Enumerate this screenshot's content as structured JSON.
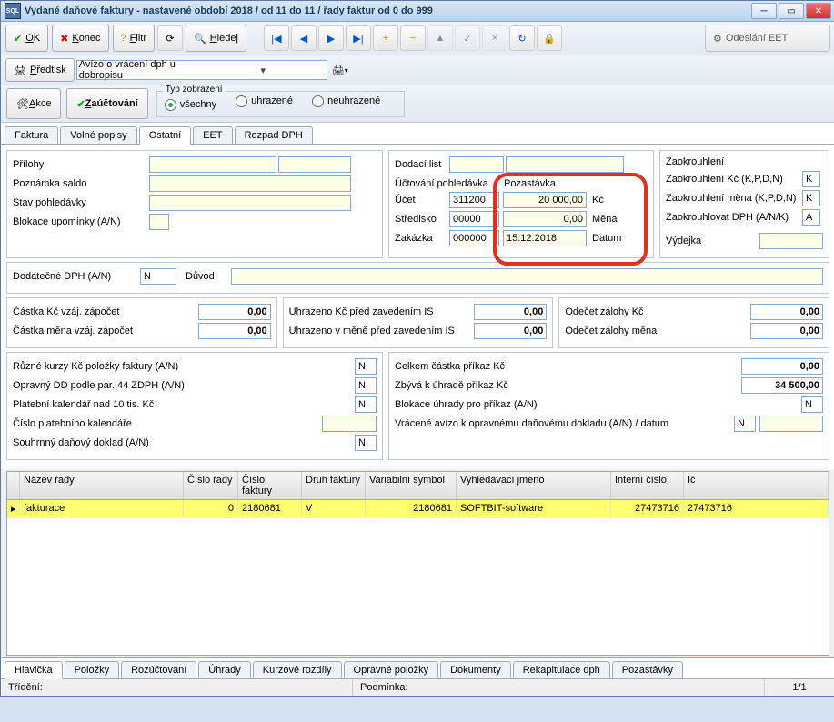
{
  "window": {
    "title": "Vydané daňové faktury - nastavené období 2018 / od 11 do 11 / řady faktur od 0 do 999"
  },
  "tb": {
    "ok": "OK",
    "konec": "Konec",
    "filtr": "Filtr",
    "hledej": "Hledej",
    "eet": "Odeslání EET",
    "predtisk": "Předtisk",
    "combo": "Avízo o vrácení dph u dobropisu",
    "akce": "Akce",
    "zauct": "Zaúčtování",
    "typ": "Typ zobrazení",
    "vsechny": "všechny",
    "uhrazene": "uhrazené",
    "neuhrazene": "neuhrazené"
  },
  "tabs": [
    "Faktura",
    "Volné popisy",
    "Ostatní",
    "EET",
    "Rozpad DPH"
  ],
  "active_tab": 2,
  "left": {
    "prilohy": "Přílohy",
    "poznamka": "Poznámka saldo",
    "stav": "Stav pohledávky",
    "blokace": "Blokace upomínky (A/N)"
  },
  "mid": {
    "dodaci": "Dodací list",
    "uctovani": "Účtování pohledávka",
    "ucet": "Účet",
    "ucet_v": "311200",
    "stred": "Středisko",
    "stred_v": "00000",
    "zak": "Zakázka",
    "zak_v": "000000",
    "pozast": "Pozastávka",
    "kc_v": "20 000,00",
    "kc": "Kč",
    "mena_v": "0,00",
    "mena": "Měna",
    "datum_v": "15.12.2018",
    "datum": "Datum"
  },
  "right": {
    "zaok_title": "Zaokrouhlení",
    "zaok_kc": "Zaokrouhlení Kč (K,P,D,N)",
    "zaok_kc_v": "K",
    "zaok_mena": "Zaokrouhlení měna (K,P,D,N)",
    "zaok_mena_v": "K",
    "zaok_dph": "Zaokrouhlovat DPH (A/N/K)",
    "zaok_dph_v": "A",
    "vydejka": "Výdejka"
  },
  "dph": {
    "lbl": "Dodatečné DPH (A/N)",
    "val": "N",
    "duvod": "Důvod"
  },
  "amounts": {
    "a1": "Částka Kč vzáj. zápočet",
    "a1v": "0,00",
    "a2": "Částka měna vzáj. zápočet",
    "a2v": "0,00",
    "b1": "Uhrazeno Kč před zavedením IS",
    "b1v": "0,00",
    "b2": "Uhrazeno v měně před zavedením IS",
    "b2v": "0,00",
    "c1": "Odečet zálohy Kč",
    "c1v": "0,00",
    "c2": "Odečet zálohy měna",
    "c2v": "0,00"
  },
  "opts": {
    "r1": "Různé kurzy Kč položky faktury (A/N)",
    "r1v": "N",
    "r2": "Opravný DD podle par. 44 ZDPH (A/N)",
    "r2v": "N",
    "r3": "Platební kalendář nad 10 tis. Kč",
    "r3v": "N",
    "r4": "Číslo platebního kalendáře",
    "r5": "Souhrnný daňový doklad (A/N)",
    "r5v": "N",
    "s1": "Celkem částka příkaz Kč",
    "s1v": "0,00",
    "s2": "Zbývá k úhradě příkaz Kč",
    "s2v": "34 500,00",
    "s3": "Blokace úhrady pro příkaz (A/N)",
    "s3v": "N",
    "s4": "Vrácené avízo k opravnému daňovému dokladu (A/N) / datum",
    "s4v": "N"
  },
  "grid": {
    "cols": [
      "Název řady",
      "Číslo řady",
      "Číslo faktury",
      "Druh faktury",
      "Variabilní symbol",
      "Vyhledávací jméno",
      "Interní číslo",
      "Ič"
    ],
    "row": [
      "fakturace",
      "0",
      "2180681",
      "V",
      "2180681",
      "SOFTBIT-software",
      "27473716",
      "27473716"
    ]
  },
  "btabs": [
    "Hlavička",
    "Položky",
    "Rozúčtování",
    "Úhrady",
    "Kurzové rozdíly",
    "Opravné položky",
    "Dokumenty",
    "Rekapitulace dph",
    "Pozastávky"
  ],
  "status": {
    "trideni": "Třídění:",
    "podm": "Podmínka:",
    "pager": "1/1"
  }
}
